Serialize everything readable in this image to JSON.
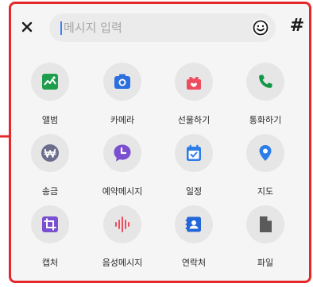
{
  "composer": {
    "close_icon": "close-icon",
    "placeholder": "메시지 입력",
    "emoji_icon": "smiley-icon",
    "hash_label": "#"
  },
  "colors": {
    "highlight": "#e5282a",
    "panel_background": "#f5f5f5",
    "field_background": "#ebebeb",
    "tile_background": "#e6e6e6",
    "caret": "#3b7ff6"
  },
  "attachments": [
    {
      "label": "앨범",
      "icon": "photo-album-icon",
      "color": "#1e9e4d"
    },
    {
      "label": "카메라",
      "icon": "camera-icon",
      "color": "#2c6fe0"
    },
    {
      "label": "선물하기",
      "icon": "gift-icon",
      "color": "#ee4d5f"
    },
    {
      "label": "통화하기",
      "icon": "phone-icon",
      "color": "#139747"
    },
    {
      "label": "송금",
      "icon": "won-currency-icon",
      "color": "#6b6d8c"
    },
    {
      "label": "예약메시지",
      "icon": "scheduled-message-icon",
      "color": "#7a4fd0"
    },
    {
      "label": "일정",
      "icon": "calendar-check-icon",
      "color": "#2c7de8"
    },
    {
      "label": "지도",
      "icon": "map-pin-icon",
      "color": "#2c7de8"
    },
    {
      "label": "캡처",
      "icon": "crop-icon",
      "color": "#7a4fd0"
    },
    {
      "label": "음성메시지",
      "icon": "voice-waveform-icon",
      "color": "#ee4d5f"
    },
    {
      "label": "연락처",
      "icon": "contact-card-icon",
      "color": "#2467d8"
    },
    {
      "label": "파일",
      "icon": "file-icon",
      "color": "#5a5a5a"
    }
  ]
}
